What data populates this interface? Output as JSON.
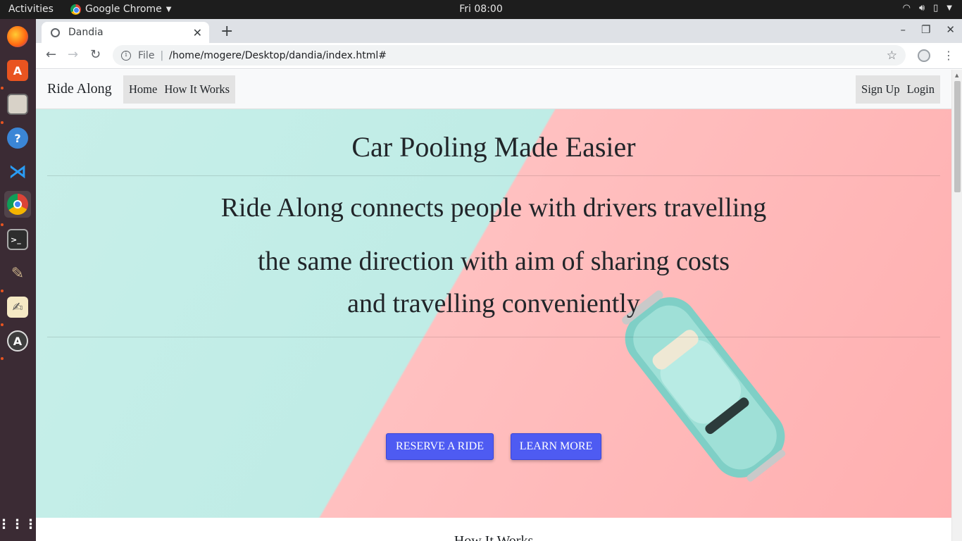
{
  "system": {
    "activities": "Activities",
    "app_menu": "Google Chrome",
    "clock": "Fri 08:00"
  },
  "dock": {
    "items": [
      "firefox-icon",
      "software-center-icon",
      "files-icon",
      "help-icon",
      "vscode-icon",
      "chrome-icon",
      "terminal-icon",
      "gimp-icon",
      "text-editor-icon",
      "updater-icon",
      "app-grid-icon"
    ]
  },
  "browser": {
    "tab_title": "Dandia",
    "address_scheme": "File",
    "url": "/home/mogere/Desktop/dandia/index.html#"
  },
  "page": {
    "brand": "Ride Along",
    "nav_left": [
      "Home",
      "How It Works"
    ],
    "nav_right": [
      "Sign Up",
      "Login"
    ],
    "hero_title": "Car Pooling Made Easier",
    "hero_lines": [
      "Ride Along connects people with drivers travelling",
      "the same direction with aim of sharing costs",
      "and travelling conveniently"
    ],
    "buttons": {
      "reserve": "RESERVE A RIDE",
      "learn": "LEARN MORE"
    },
    "section2_title": "How It Works"
  },
  "colors": {
    "hero_teal": "#c8efe9",
    "hero_pink": "#ffb6b7",
    "button_primary": "#4e5bf2",
    "dock_bg": "#3b2b34",
    "topbar_bg": "#1d1d1d"
  }
}
